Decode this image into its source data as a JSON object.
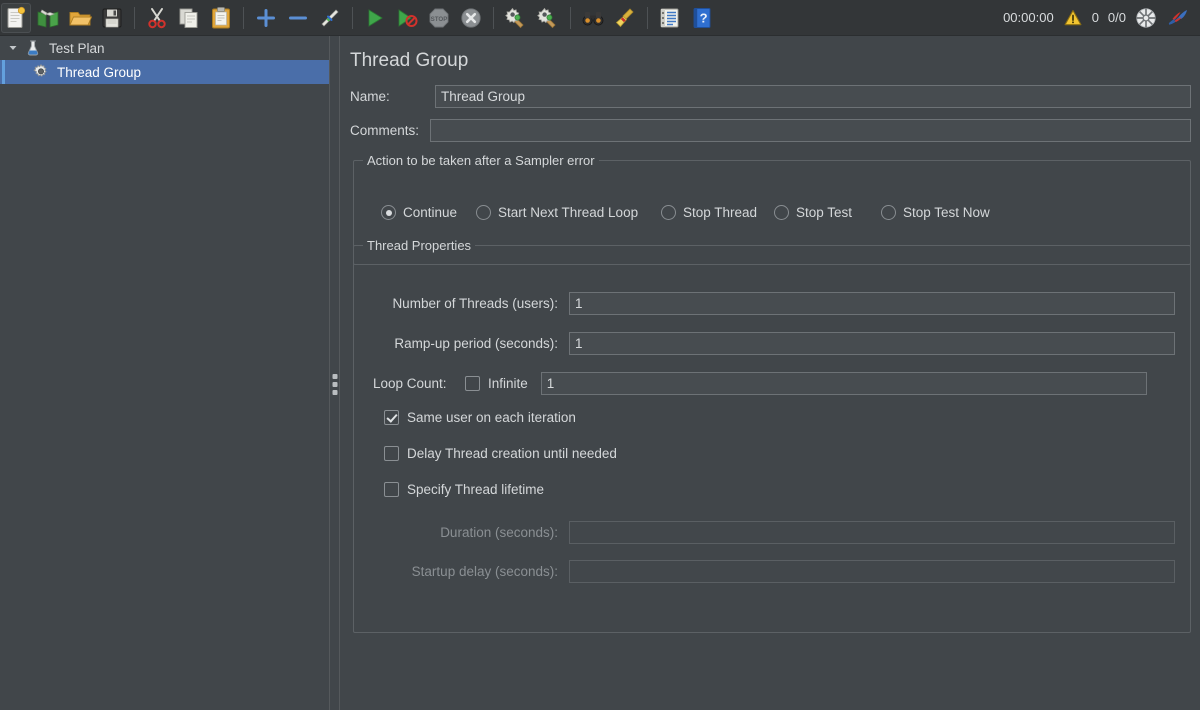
{
  "toolbar": {
    "buttons": [
      {
        "name": "new-button",
        "icon": "new-document-icon",
        "label": "New"
      },
      {
        "name": "templates-button",
        "icon": "templates-books-icon",
        "label": "Templates"
      },
      {
        "name": "open-button",
        "icon": "open-folder-icon",
        "label": "Open"
      },
      {
        "name": "save-button",
        "icon": "save-floppy-icon",
        "label": "Save Test Plan"
      },
      {
        "name": "cut-button",
        "icon": "cut-scissors-icon",
        "label": "Cut"
      },
      {
        "name": "copy-button",
        "icon": "copy-pages-icon",
        "label": "Copy"
      },
      {
        "name": "paste-button",
        "icon": "paste-clipboard-icon",
        "label": "Paste"
      },
      {
        "name": "expand-all-button",
        "icon": "plus-icon",
        "label": "Expand All"
      },
      {
        "name": "collapse-all-button",
        "icon": "minus-icon",
        "label": "Collapse All"
      },
      {
        "name": "toggle-button",
        "icon": "toggle-pencils-icon",
        "label": "Toggle"
      },
      {
        "name": "start-button",
        "icon": "play-green-icon",
        "label": "Start"
      },
      {
        "name": "start-no-pauses-button",
        "icon": "play-no-pauses-icon",
        "label": "Start no pauses"
      },
      {
        "name": "stop-button",
        "icon": "stop-sign-icon",
        "label": "Stop"
      },
      {
        "name": "shutdown-button",
        "icon": "shutdown-x-icon",
        "label": "Shutdown"
      },
      {
        "name": "remote-start-all-button",
        "icon": "remote-start-gear-icon",
        "label": "Remote Start All"
      },
      {
        "name": "remote-stop-all-button",
        "icon": "remote-stop-gear-icon",
        "label": "Remote Stop All"
      },
      {
        "name": "search-button",
        "icon": "binoculars-search-icon",
        "label": "Search"
      },
      {
        "name": "clear-button",
        "icon": "broom-clear-icon",
        "label": "Clear All"
      },
      {
        "name": "log-button",
        "icon": "log-viewer-icon",
        "label": "Toggle Log Viewer"
      },
      {
        "name": "help-button",
        "icon": "help-book-icon",
        "label": "Help"
      }
    ]
  },
  "status": {
    "elapsed_time": "00:00:00",
    "warning_icon": "warning-triangle-icon",
    "warning_count": "0",
    "thread_counts": "0/0",
    "connection_icon": "connection-globe-icon",
    "logo_icon": "jmeter-feather-icon"
  },
  "tree": {
    "items": [
      {
        "name": "tree-item-test-plan",
        "label": "Test Plan",
        "icon": "test-plan-icon",
        "depth": 0,
        "expanded": true,
        "selected": false
      },
      {
        "name": "tree-item-thread-group",
        "label": "Thread Group",
        "icon": "thread-group-gear-icon",
        "depth": 1,
        "expanded": false,
        "selected": true
      }
    ]
  },
  "panel": {
    "title": "Thread Group",
    "name_label": "Name:",
    "name_value": "Thread Group",
    "comments_label": "Comments:",
    "comments_value": "",
    "comments_placeholder": "",
    "sampler_error": {
      "legend": "Action to be taken after a Sampler error",
      "options": [
        {
          "name": "radio-continue",
          "label": "Continue",
          "selected": true
        },
        {
          "name": "radio-start-next-thread-loop",
          "label": "Start Next Thread Loop",
          "selected": false
        },
        {
          "name": "radio-stop-thread",
          "label": "Stop Thread",
          "selected": false
        },
        {
          "name": "radio-stop-test",
          "label": "Stop Test",
          "selected": false
        },
        {
          "name": "radio-stop-test-now",
          "label": "Stop Test Now",
          "selected": false
        }
      ]
    },
    "thread_properties": {
      "legend": "Thread Properties",
      "num_threads_label": "Number of Threads (users):",
      "num_threads_value": "1",
      "ramp_up_label": "Ramp-up period (seconds):",
      "ramp_up_value": "1",
      "loop_count_label": "Loop Count:",
      "loop_infinite_label": "Infinite",
      "loop_infinite_checked": false,
      "loop_count_value": "1",
      "same_user_label": "Same user on each iteration",
      "same_user_checked": true,
      "delay_thread_label": "Delay Thread creation until needed",
      "delay_thread_checked": false,
      "specify_lifetime_label": "Specify Thread lifetime",
      "specify_lifetime_checked": false,
      "duration_label": "Duration (seconds):",
      "duration_value": "",
      "duration_disabled": true,
      "startup_delay_label": "Startup delay (seconds):",
      "startup_delay_value": "",
      "startup_delay_disabled": true
    }
  },
  "colors": {
    "background": "#41464a",
    "toolbar": "#333638",
    "selection": "#4a6ea9",
    "field_bg": "#474c50",
    "text": "#d6d9db",
    "text_dim": "#8a8f93",
    "accent_blue": "#4a90d9",
    "green": "#3fa64a"
  }
}
